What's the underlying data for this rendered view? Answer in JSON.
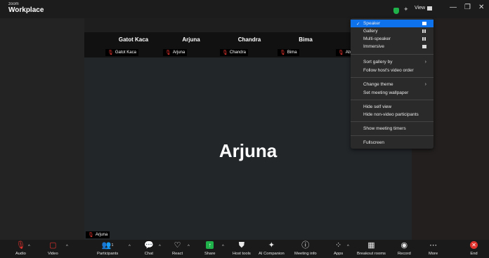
{
  "app": {
    "brand_small": "zoom",
    "brand_big": "Workplace"
  },
  "titlebar": {
    "view_label": "View",
    "minimize_glyph": "—",
    "restore_glyph": "❐",
    "close_glyph": "✕"
  },
  "thumbnails": [
    {
      "name": "Gatot Kaca",
      "tag": "Gatot Kaca"
    },
    {
      "name": "Arjuna",
      "tag": "Arjuna"
    },
    {
      "name": "Chandra",
      "tag": "Chandra"
    },
    {
      "name": "Bima",
      "tag": "Bima"
    },
    {
      "tag": "Abi"
    }
  ],
  "main": {
    "speaker_name": "Arjuna",
    "speaker_tag": "Arjuna"
  },
  "view_menu": {
    "items": [
      {
        "label": "Speaker",
        "checked": true
      },
      {
        "label": "Gallery"
      },
      {
        "label": "Multi-speaker"
      },
      {
        "label": "Immersive"
      },
      {
        "label": "Sort gallery by"
      },
      {
        "label": "Follow host's video order"
      },
      {
        "label": "Change theme"
      },
      {
        "label": "Set meeting wallpaper"
      },
      {
        "label": "Hide self view"
      },
      {
        "label": "Hide non-video participants"
      },
      {
        "label": "Show meeting timers"
      },
      {
        "label": "Fullscreen"
      }
    ]
  },
  "toolbar": {
    "audio": "Audio",
    "video": "Video",
    "participants": "Participants",
    "participants_count": "1",
    "chat": "Chat",
    "react": "React",
    "share": "Share",
    "host_tools": "Host tools",
    "ai_companion": "AI Companion",
    "meeting_info": "Meeting info",
    "apps": "Apps",
    "breakout_rooms": "Breakout rooms",
    "record": "Record",
    "more": "More",
    "end": "End"
  },
  "colors": {
    "accent": "#0e72ed",
    "muted": "#e0322d",
    "share": "#1fb24a"
  }
}
